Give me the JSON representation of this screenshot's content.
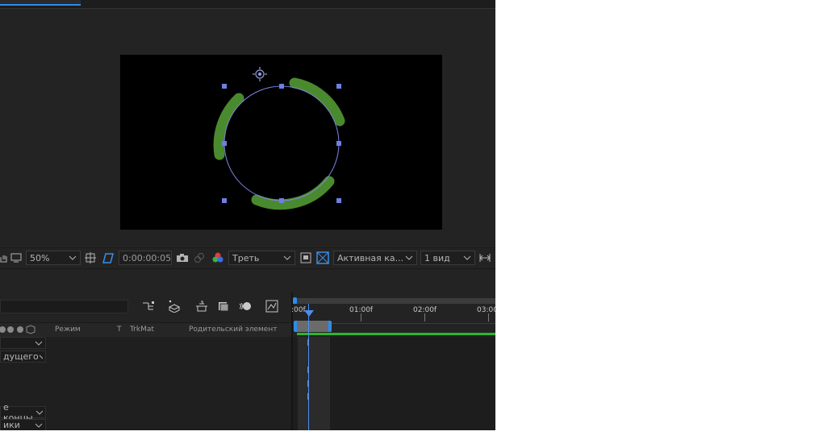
{
  "viewer_toolbar": {
    "zoom": "50%",
    "timecode": "0:00:00:05",
    "resolution": "Треть",
    "camera": "Активная ка...",
    "views": "1 вид"
  },
  "timeline": {
    "columns": {
      "mode": "Режим",
      "t": "T",
      "trkmat": "TrkMat",
      "parent": "Родительский элемент"
    },
    "ruler_labels": [
      ":00f",
      "01:00f",
      "02:00f",
      "03:00"
    ],
    "layer_dropdowns": [
      "",
      "дущего",
      "е концы",
      "ики"
    ],
    "keyframe_glyph": "I"
  },
  "colors": {
    "panel_bg": "#232323",
    "stroke_green": "#4a8a2e",
    "handle_blue": "#6f7fe0",
    "accent_blue": "#2d8ceb",
    "bar_green": "#2fb52f"
  }
}
